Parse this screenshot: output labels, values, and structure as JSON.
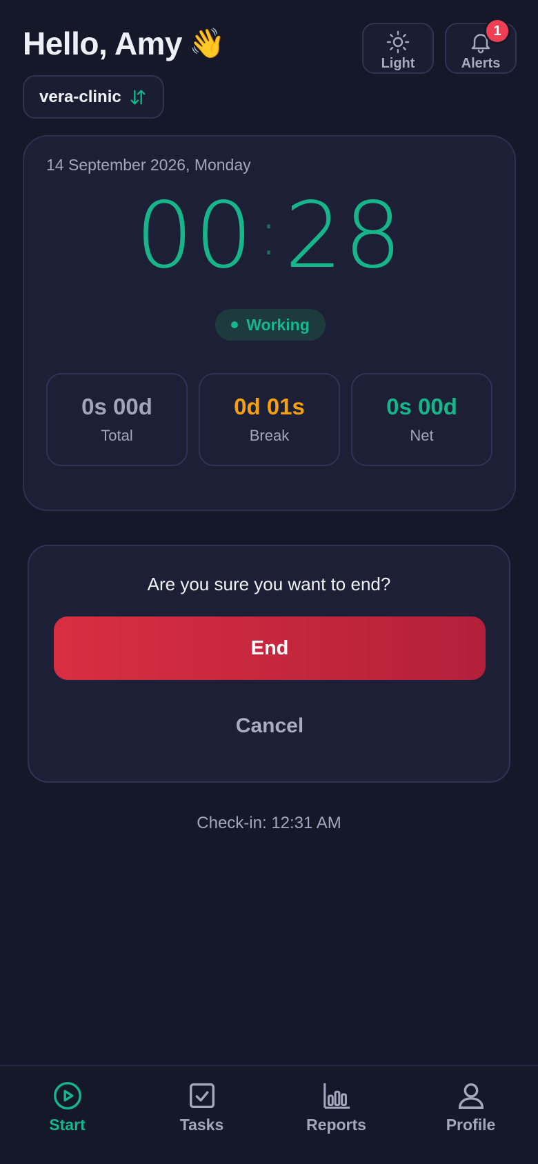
{
  "header": {
    "greeting": "Hello, Amy",
    "wave_emoji": "👋",
    "light_label": "Light",
    "alerts_label": "Alerts",
    "alerts_count": "1",
    "org_name": "vera-clinic"
  },
  "timer": {
    "date": "14 September 2026, Monday",
    "minutes": "00",
    "seconds": "28",
    "status": "Working",
    "stats": {
      "total_value": "0s 00d",
      "total_label": "Total",
      "break_value": "0d 01s",
      "break_label": "Break",
      "net_value": "0s 00d",
      "net_label": "Net"
    }
  },
  "confirm": {
    "question": "Are you sure you want to end?",
    "end_label": "End",
    "cancel_label": "Cancel"
  },
  "checkin": "Check-in: 12:31 AM",
  "nav": {
    "start": "Start",
    "tasks": "Tasks",
    "reports": "Reports",
    "profile": "Profile"
  },
  "colors": {
    "background": "#151829",
    "accent_green": "#16b58a",
    "break_orange": "#f5a00e",
    "danger_red": "#d92e42"
  },
  "icons": {
    "light": "sun-icon",
    "alerts": "bell-icon",
    "org_switch": "swap-vertical-icon",
    "start": "play-circle-icon",
    "tasks": "checkbox-icon",
    "reports": "bar-chart-icon",
    "profile": "user-icon"
  }
}
